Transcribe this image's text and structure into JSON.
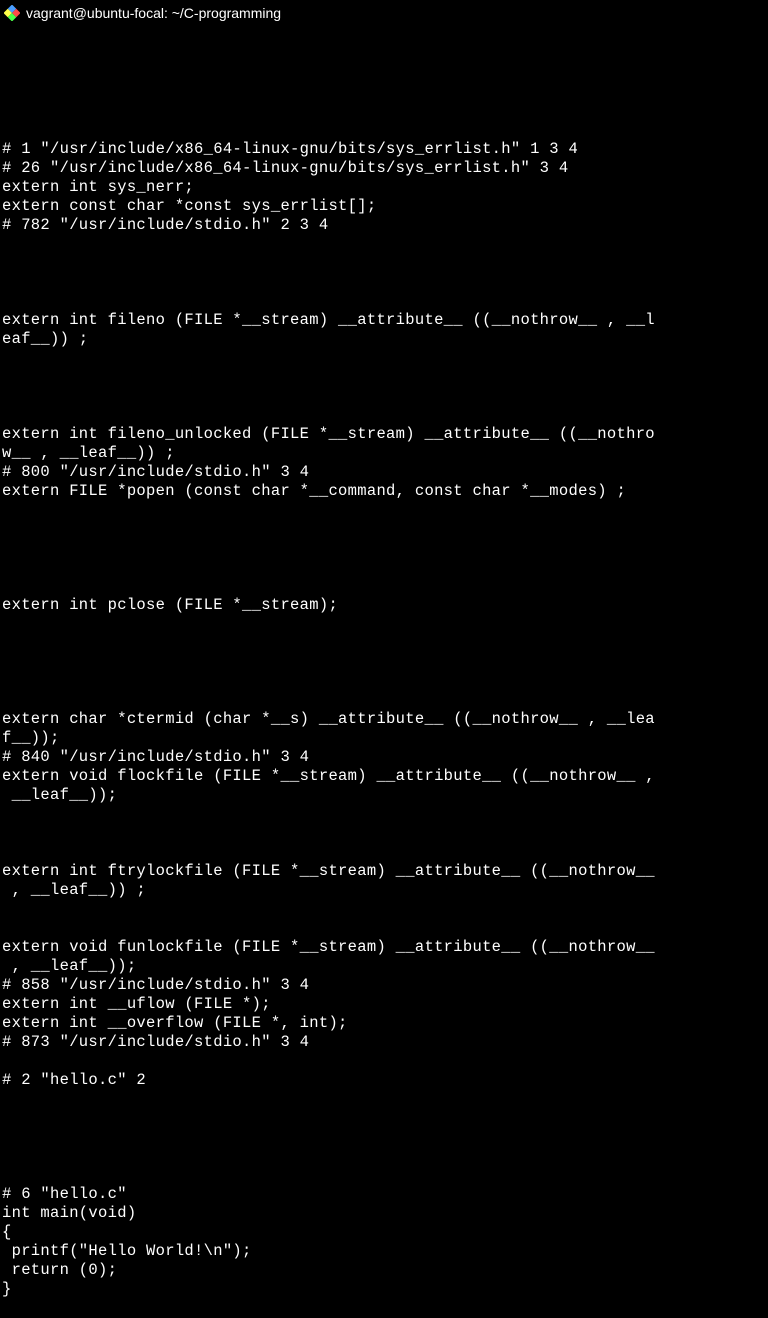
{
  "window": {
    "title": "vagrant@ubuntu-focal: ~/C-programming"
  },
  "terminal": {
    "lines": [
      "",
      "",
      "",
      "",
      "# 1 \"/usr/include/x86_64-linux-gnu/bits/sys_errlist.h\" 1 3 4",
      "# 26 \"/usr/include/x86_64-linux-gnu/bits/sys_errlist.h\" 3 4",
      "extern int sys_nerr;",
      "extern const char *const sys_errlist[];",
      "# 782 \"/usr/include/stdio.h\" 2 3 4",
      "",
      "",
      "",
      "",
      "extern int fileno (FILE *__stream) __attribute__ ((__nothrow__ , __l",
      "eaf__)) ;",
      "",
      "",
      "",
      "",
      "extern int fileno_unlocked (FILE *__stream) __attribute__ ((__nothro",
      "w__ , __leaf__)) ;",
      "# 800 \"/usr/include/stdio.h\" 3 4",
      "extern FILE *popen (const char *__command, const char *__modes) ;",
      "",
      "",
      "",
      "",
      "",
      "extern int pclose (FILE *__stream);",
      "",
      "",
      "",
      "",
      "",
      "extern char *ctermid (char *__s) __attribute__ ((__nothrow__ , __lea",
      "f__));",
      "# 840 \"/usr/include/stdio.h\" 3 4",
      "extern void flockfile (FILE *__stream) __attribute__ ((__nothrow__ ,",
      " __leaf__));",
      "",
      "",
      "",
      "extern int ftrylockfile (FILE *__stream) __attribute__ ((__nothrow__",
      " , __leaf__)) ;",
      "",
      "",
      "extern void funlockfile (FILE *__stream) __attribute__ ((__nothrow__",
      " , __leaf__));",
      "# 858 \"/usr/include/stdio.h\" 3 4",
      "extern int __uflow (FILE *);",
      "extern int __overflow (FILE *, int);",
      "# 873 \"/usr/include/stdio.h\" 3 4",
      "",
      "# 2 \"hello.c\" 2",
      "",
      "",
      "",
      "",
      "",
      "# 6 \"hello.c\"",
      "int main(void)",
      "{",
      " printf(\"Hello World!\\n\");",
      " return (0);",
      "}"
    ]
  }
}
